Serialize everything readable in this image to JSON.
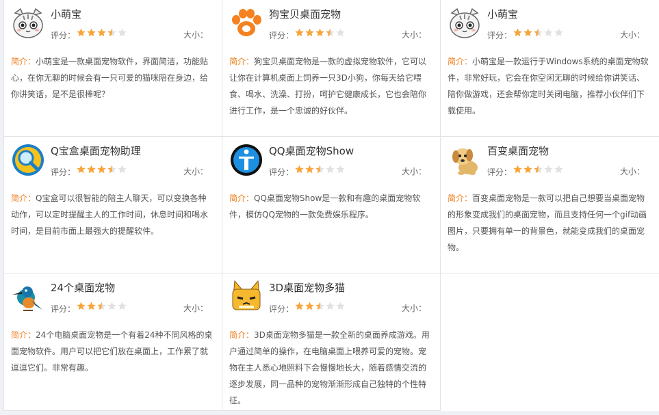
{
  "labels": {
    "rating": "评分：",
    "size": "大小：",
    "intro": "简介："
  },
  "colors": {
    "star_on": "#f7a53b",
    "star_off": "#e1e1e1",
    "intro_label": "#f07c1b"
  },
  "apps": [
    {
      "name": "小萌宝",
      "icon": "cat-face-icon",
      "rating": 3.5,
      "description": "小萌宝是一款桌面宠物软件，界面简洁，功能贴心，在你无聊的时候会有一只可爱的猫咪陪在身边，给你讲笑话，是不是很棒呢？"
    },
    {
      "name": "狗宝贝桌面宠物",
      "icon": "paw-icon",
      "rating": 3.5,
      "description": "狗宝贝桌面宠物是一款的虚拟宠物软件，它可以让你在计算机桌面上饲养一只3D小狗，你每天给它喂食、喝水、洗澡、打扮，呵护它健康成长，它也会陪你进行工作，是一个忠诚的好伙伴。"
    },
    {
      "name": "小萌宝",
      "icon": "cat-face-icon",
      "rating": 2.5,
      "description": "小萌宝是一款运行于Windows系统的桌面宠物软件，非常好玩，它会在你空闲无聊的时候给你讲笑话、陪你做游戏，还会帮你定时关闭电脑，推荐小伙伴们下载使用。"
    },
    {
      "name": "Q宝盒桌面宠物助理",
      "icon": "magnifier-icon",
      "rating": 3.5,
      "description": "Q宝盒可以很智能的陪主人聊天，可以变换各种动作，可以定时提醒主人的工作时间，休息时间和喝水时间，是目前市面上最强大的提醒软件。"
    },
    {
      "name": "QQ桌面宠物Show",
      "icon": "person-icon",
      "rating": 2.5,
      "description": "QQ桌面宠物Show是一款和有趣的桌面宠物软件，模仿QQ宠物的一款免费娱乐程序。"
    },
    {
      "name": "百变桌面宠物",
      "icon": "puppy-icon",
      "rating": 2.5,
      "description": "百变桌面宠物是一款可以把自己想要当桌面宠物的形象变成我们的桌面宠物，而且支持任何一个gif动画图片，只要拥有单一的背景色，就能变成我们的桌面宠物。"
    },
    {
      "name": "24个桌面宠物",
      "icon": "kingfisher-icon",
      "rating": 2.5,
      "description": "24个电脑桌面宠物是一个有着24种不同风格的桌面宠物软件。用户可以把它们放在桌面上，工作累了就逗逗它们。非常有趣。"
    },
    {
      "name": "3D桌面宠物多猫",
      "icon": "cat-mascot-icon",
      "rating": 2.5,
      "description": "3D桌面宠物多猫是一款全新的桌面养成游戏。用户通过简单的操作，在电脑桌面上喂养可爱的宠物。宠物在主人悉心地照料下会慢慢地长大，随着感情交流的逐步发展，同一品种的宠物渐渐形成自己独特的个性特征。"
    }
  ]
}
